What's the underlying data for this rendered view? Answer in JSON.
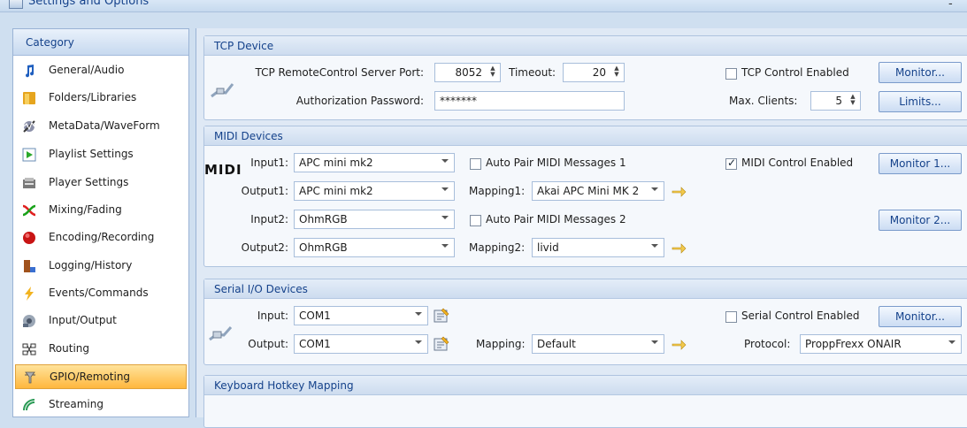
{
  "window": {
    "title": "Settings and Options",
    "min_glyph": "-"
  },
  "sidebar": {
    "header": "Category",
    "items": [
      {
        "label": "General/Audio",
        "icon": "music-note-icon"
      },
      {
        "label": "Folders/Libraries",
        "icon": "folder-icon"
      },
      {
        "label": "MetaData/WaveForm",
        "icon": "metadata-icon"
      },
      {
        "label": "Playlist Settings",
        "icon": "playlist-icon"
      },
      {
        "label": "Player Settings",
        "icon": "player-icon"
      },
      {
        "label": "Mixing/Fading",
        "icon": "mixing-icon"
      },
      {
        "label": "Encoding/Recording",
        "icon": "record-icon"
      },
      {
        "label": "Logging/History",
        "icon": "logging-icon"
      },
      {
        "label": "Events/Commands",
        "icon": "lightning-icon"
      },
      {
        "label": "Input/Output",
        "icon": "input-output-icon"
      },
      {
        "label": "Routing",
        "icon": "routing-icon"
      },
      {
        "label": "GPIO/Remoting",
        "icon": "gpio-icon",
        "selected": true
      },
      {
        "label": "Streaming",
        "icon": "streaming-icon"
      }
    ]
  },
  "tcp": {
    "header": "TCP Device",
    "port_label": "TCP RemoteControl Server Port:",
    "port_value": "8052",
    "timeout_label": "Timeout:",
    "timeout_value": "20",
    "password_label": "Authorization Password:",
    "password_value": "*******",
    "enabled_label": "TCP Control Enabled",
    "enabled": false,
    "monitor_label": "Monitor...",
    "max_clients_label": "Max. Clients:",
    "max_clients_value": "5",
    "limits_label": "Limits..."
  },
  "midi": {
    "header": "MIDI Devices",
    "logo_text": "MIDI",
    "input1_label": "Input1:",
    "input1_value": "APC mini mk2",
    "output1_label": "Output1:",
    "output1_value": "APC mini mk2",
    "autopair1_label": "Auto Pair MIDI Messages 1",
    "autopair1": false,
    "mapping1_label": "Mapping1:",
    "mapping1_value": "Akai APC Mini MK 2",
    "enabled_label": "MIDI Control Enabled",
    "enabled": true,
    "monitor1_label": "Monitor 1...",
    "input2_label": "Input2:",
    "input2_value": "OhmRGB",
    "output2_label": "Output2:",
    "output2_value": "OhmRGB",
    "autopair2_label": "Auto Pair MIDI Messages 2",
    "autopair2": false,
    "mapping2_label": "Mapping2:",
    "mapping2_value": "livid",
    "monitor2_label": "Monitor 2..."
  },
  "serial": {
    "header": "Serial I/O Devices",
    "input_label": "Input:",
    "input_value": "COM1",
    "output_label": "Output:",
    "output_value": "COM1",
    "mapping_label": "Mapping:",
    "mapping_value": "Default",
    "enabled_label": "Serial Control Enabled",
    "enabled": false,
    "monitor_label": "Monitor...",
    "protocol_label": "Protocol:",
    "protocol_value": "ProppFrexx ONAIR"
  },
  "keyboard": {
    "header": "Keyboard Hotkey Mapping"
  },
  "colors": {
    "accent": "#15428b",
    "selected_bg": "#ffc757",
    "panel_bg": "#dfe9f5"
  }
}
